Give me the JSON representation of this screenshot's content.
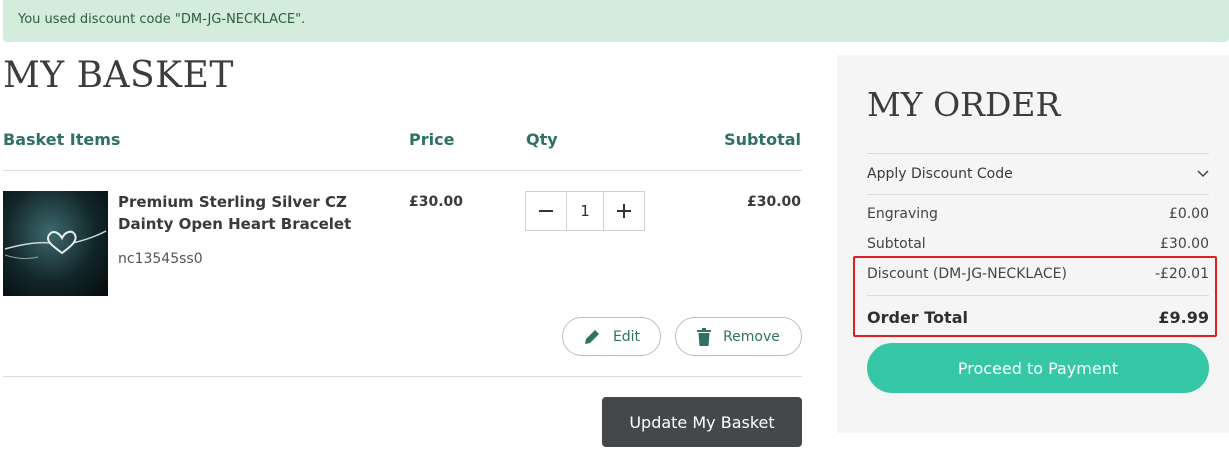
{
  "alert": {
    "message": "You used discount code \"DM-JG-NECKLACE\"."
  },
  "basket": {
    "title": "MY BASKET",
    "columns": {
      "items": "Basket Items",
      "price": "Price",
      "qty": "Qty",
      "subtotal": "Subtotal"
    },
    "item": {
      "name": "Premium Sterling Silver CZ Dainty Open Heart Bracelet",
      "sku": "nc13545ss0",
      "price": "£30.00",
      "qty": "1",
      "subtotal": "£30.00",
      "image_icon": "heart-bracelet-image"
    },
    "edit_label": "Edit",
    "remove_label": "Remove",
    "update_label": "Update My Basket"
  },
  "order": {
    "title": "MY ORDER",
    "discount_toggle_label": "Apply Discount Code",
    "engraving": {
      "label": "Engraving",
      "value": "£0.00"
    },
    "subtotal": {
      "label": "Subtotal",
      "value": "£30.00"
    },
    "discount": {
      "label": "Discount (DM-JG-NECKLACE)",
      "value": "-£20.01"
    },
    "total": {
      "label": "Order Total",
      "value": "£9.99"
    },
    "pay_label": "Proceed to Payment"
  },
  "colors": {
    "accent": "#2f7164",
    "pay_button": "#36c8a6",
    "update_button": "#45484b",
    "alert_bg": "#d4ecdc",
    "highlight": "#e02020"
  }
}
